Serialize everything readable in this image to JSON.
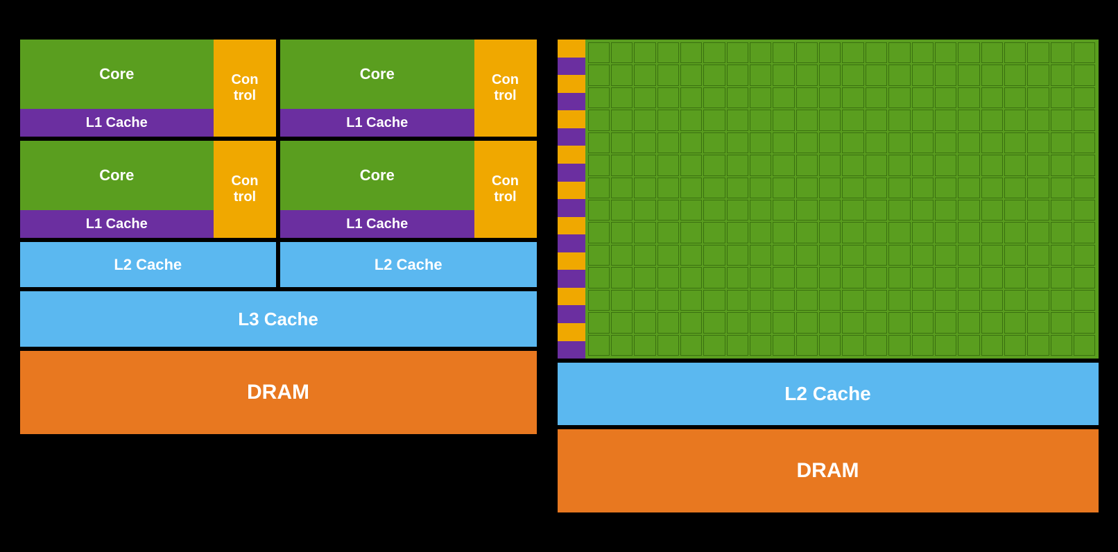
{
  "left": {
    "core_labels": [
      "Core",
      "Core",
      "Core",
      "Core"
    ],
    "control_labels": [
      "Con\ntrol",
      "Con\ntrol",
      "Con\ntrol",
      "Con\ntrol"
    ],
    "l1_labels": [
      "L1 Cache",
      "L1 Cache",
      "L1 Cache",
      "L1 Cache"
    ],
    "l2_labels": [
      "L2 Cache",
      "L2 Cache"
    ],
    "l3_label": "L3 Cache",
    "dram_label": "DRAM"
  },
  "right": {
    "l2_label": "L2 Cache",
    "dram_label": "DRAM",
    "grid_cols": 22,
    "grid_rows": 14
  }
}
